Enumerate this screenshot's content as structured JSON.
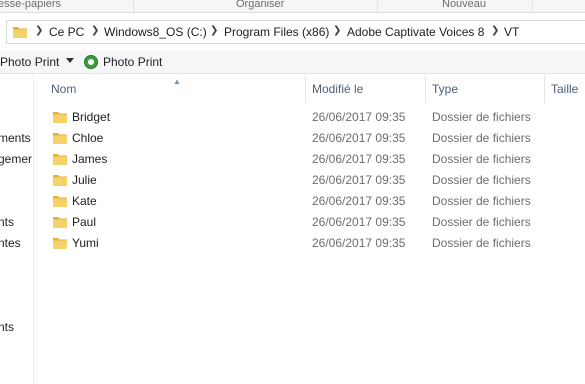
{
  "ribbon": {
    "groups": [
      "esse-papiers",
      "Organiser",
      "Nouveau"
    ]
  },
  "address_bar": {
    "icon": "folder-icon",
    "crumbs": [
      "Ce PC",
      "Windows8_OS (C:)",
      "Program Files (x86)",
      "Adobe Captivate Voices 8",
      "VT"
    ]
  },
  "toolbar": {
    "photo_print_drop_label": "Photo Print",
    "photo_print_label": "Photo Print"
  },
  "nav_pane": {
    "items": [
      "ments",
      "gemer",
      "nts",
      "ntes",
      "nts"
    ]
  },
  "columns": {
    "name": "Nom",
    "modified": "Modifié le",
    "type": "Type",
    "size": "Taille"
  },
  "files": [
    {
      "name": "Bridget",
      "modified": "26/06/2017 09:35",
      "type": "Dossier de fichiers"
    },
    {
      "name": "Chloe",
      "modified": "26/06/2017 09:35",
      "type": "Dossier de fichiers"
    },
    {
      "name": "James",
      "modified": "26/06/2017 09:35",
      "type": "Dossier de fichiers"
    },
    {
      "name": "Julie",
      "modified": "26/06/2017 09:35",
      "type": "Dossier de fichiers"
    },
    {
      "name": "Kate",
      "modified": "26/06/2017 09:35",
      "type": "Dossier de fichiers"
    },
    {
      "name": "Paul",
      "modified": "26/06/2017 09:35",
      "type": "Dossier de fichiers"
    },
    {
      "name": "Yumi",
      "modified": "26/06/2017 09:35",
      "type": "Dossier de fichiers"
    }
  ],
  "colors": {
    "folder_fill": "#f6d26b",
    "folder_tab": "#e3b13c",
    "header_text": "#4c607a"
  }
}
